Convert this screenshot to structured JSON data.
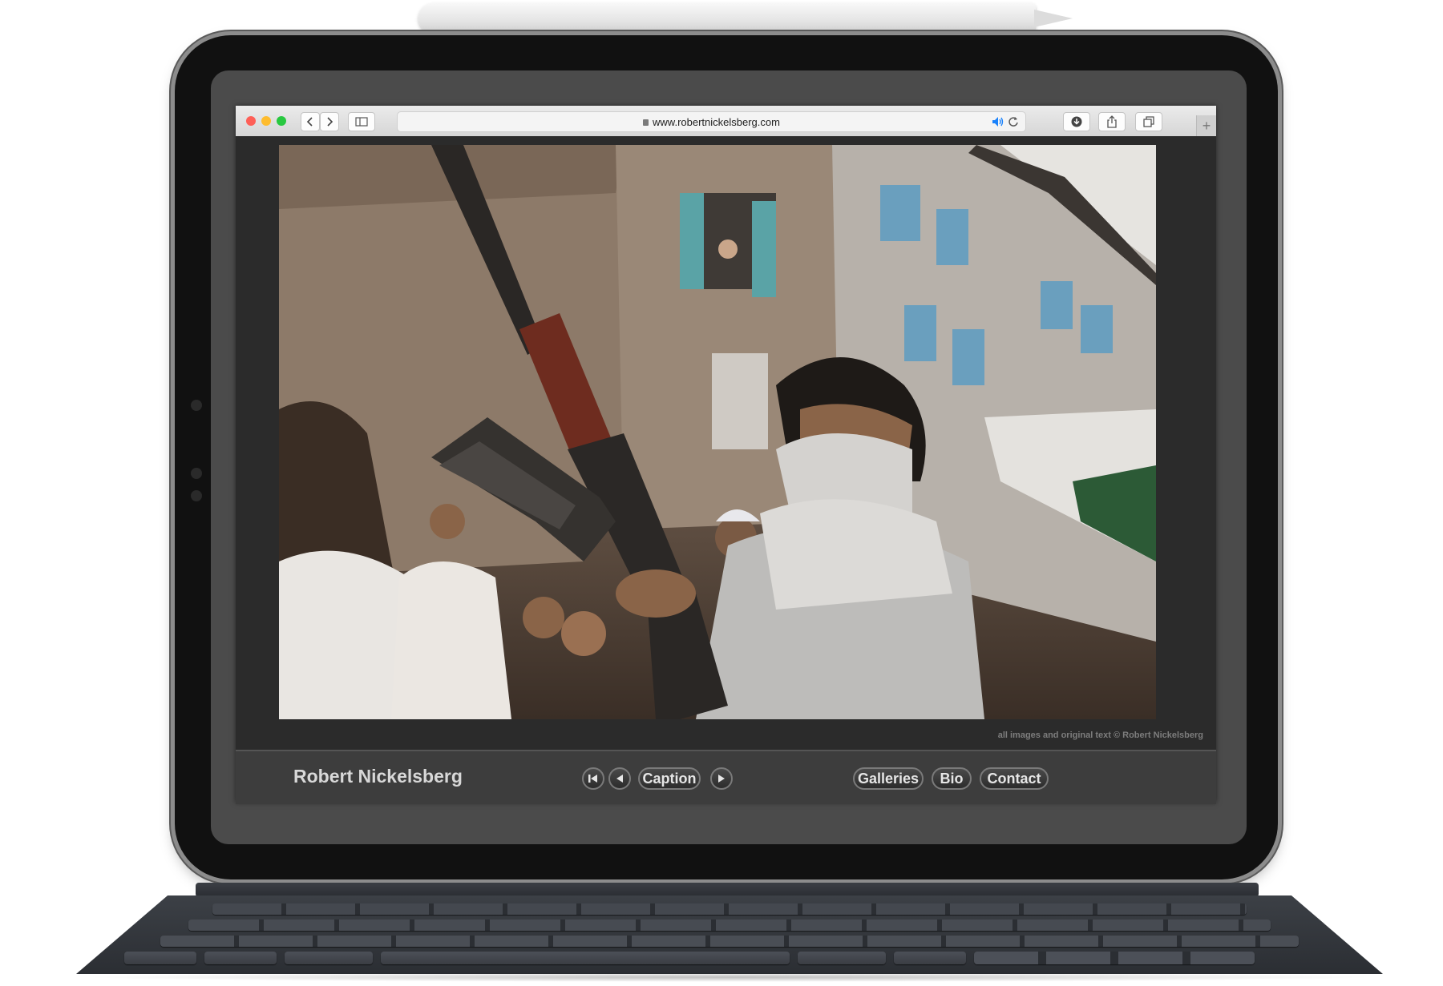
{
  "browser": {
    "url": "www.robertnickelsberg.com",
    "new_tab_label": "+"
  },
  "photo": {
    "copyright": "all images and original text © Robert Nickelsberg"
  },
  "bottom_bar": {
    "site_name": "Robert Nickelsberg",
    "caption_label": "Caption",
    "nav": [
      "Galleries",
      "Bio",
      "Contact"
    ]
  },
  "colors": {
    "close": "#fe5f57",
    "minimize": "#febc2e",
    "zoom": "#28c840",
    "audio_icon": "#1a82fb"
  },
  "icons": [
    "back-icon",
    "forward-icon",
    "sidebar-icon",
    "lock-icon",
    "speaker-icon",
    "reload-icon",
    "download-icon",
    "share-icon",
    "tabs-icon",
    "first-icon",
    "prev-icon",
    "next-icon"
  ]
}
